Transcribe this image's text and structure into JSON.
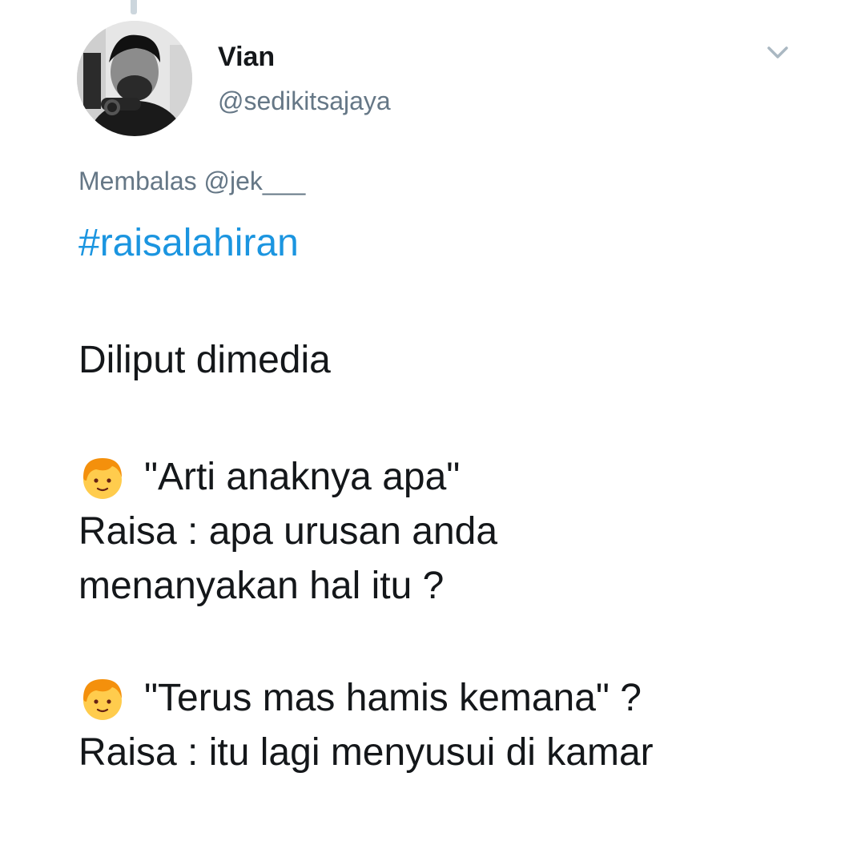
{
  "tweet": {
    "author": {
      "display_name": "Vian",
      "handle": "@sedikitsajaya",
      "avatar_icon": "profile-photo"
    },
    "menu_icon": "chevron-down-icon",
    "reply_prefix": "Membalas",
    "reply_to": "@jek___",
    "hashtag": "#raisalahiran",
    "lines": {
      "intro": "Diliput dimedia",
      "q1": "\"Arti anaknya apa\"",
      "a1_line1": "Raisa : apa urusan anda",
      "a1_line2": "menanyakan hal itu ?",
      "q2": "\"Terus mas hamis kemana\" ?",
      "a2": "Raisa : itu lagi menyusui di kamar"
    },
    "question_emoji": "boy-face-emoji"
  },
  "colors": {
    "hashtag": "#1b95e0",
    "secondary_text": "#657786",
    "primary_text": "#14171a",
    "emoji_skin": "#ffcc4d",
    "emoji_hair": "#f4900c"
  }
}
